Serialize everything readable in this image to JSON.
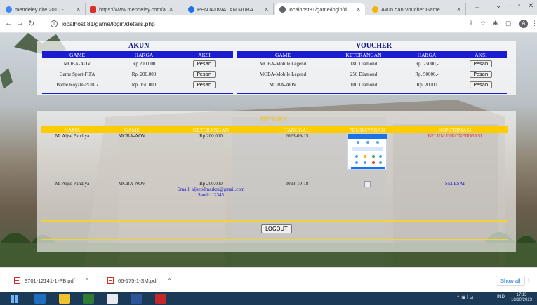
{
  "browser": {
    "tabs": [
      {
        "label": "mendeley cite 2010 - Penelusu",
        "favicon_color": "#4285f4",
        "active": false
      },
      {
        "label": "https://www.mendeley.com/a",
        "favicon_color": "#d93025",
        "active": false
      },
      {
        "label": "PENJADWALAN MUBALIGH C",
        "favicon_color": "#1a73e8",
        "active": false
      },
      {
        "label": "localhost81/game/login/deta",
        "favicon_color": "#5f6368",
        "active": true
      },
      {
        "label": "Akun dan Voucher Game",
        "favicon_color": "#f4b400",
        "active": false
      }
    ],
    "url": "localhost:81/game/login/details.php"
  },
  "akun": {
    "title": "AKUN",
    "headers": [
      "GAME",
      "HARGA",
      "AKSI"
    ],
    "rows": [
      {
        "game": "MOBA-AOV",
        "harga": "Rp 200.000",
        "aksi": "Pesan"
      },
      {
        "game": "Game Sport-FIFA",
        "harga": "Rp. 200.000",
        "aksi": "Pesan"
      },
      {
        "game": "Battle Royale-PUBG",
        "harga": "Rp. 150.000",
        "aksi": "Pesan"
      }
    ]
  },
  "voucher": {
    "title": "VOUCHER",
    "headers": [
      "GAME",
      "KETERANGAN",
      "HARGA",
      "AKSI"
    ],
    "rows": [
      {
        "game": "MOBA-Mobile Legend",
        "keterangan": "180 Diamond",
        "harga": "Rp. 25000,-",
        "aksi": "Pesan"
      },
      {
        "game": "MOBA-Mobile Legend",
        "keterangan": "250 Diamond",
        "harga": "Rp. 50000,-",
        "aksi": "Pesan"
      },
      {
        "game": "MOBA-AOV",
        "keterangan": "100 Diamond",
        "harga": "Rp. 20000",
        "aksi": "Pesan"
      }
    ]
  },
  "history": {
    "title": "HISTORY",
    "headers": [
      "NAMA",
      "GAME",
      "KETERANGAN",
      "TANGGAL",
      "PEMBAYARAN",
      "KONFIRMASI"
    ],
    "rows": [
      {
        "nama": "M. Aljse Pandiya",
        "game": "MOBA-AOV",
        "keterangan": "Rp 200.000",
        "email": "",
        "sandi": "",
        "tanggal": "2023-09-15",
        "konfirmasi": "BELUM DIKONFIRMASI",
        "status_color": "#e53935"
      },
      {
        "nama": "M. Aljse Pandiya",
        "game": "MOBA-AOV",
        "keterangan": "Rp 200.000",
        "email": "Email: aljsepdmarket@gmail.com",
        "sandi": "Sandi: 12345",
        "tanggal": "2023-10-18",
        "konfirmasi": "SELESAI",
        "status_color": "#1b1bd0"
      }
    ]
  },
  "logout_label": "LOGOUT",
  "downloads": [
    {
      "name": "3701-12141-1-PB.pdf"
    },
    {
      "name": "66-175-1-SM.pdf"
    }
  ],
  "show_all": "Show all",
  "taskbar": {
    "lang": "IND",
    "time": "17:13",
    "date": "18/10/2023"
  },
  "colors": {
    "blue_header": "#1b1bd0",
    "gold_header": "#ffcc00",
    "title_blue": "#14148a"
  }
}
